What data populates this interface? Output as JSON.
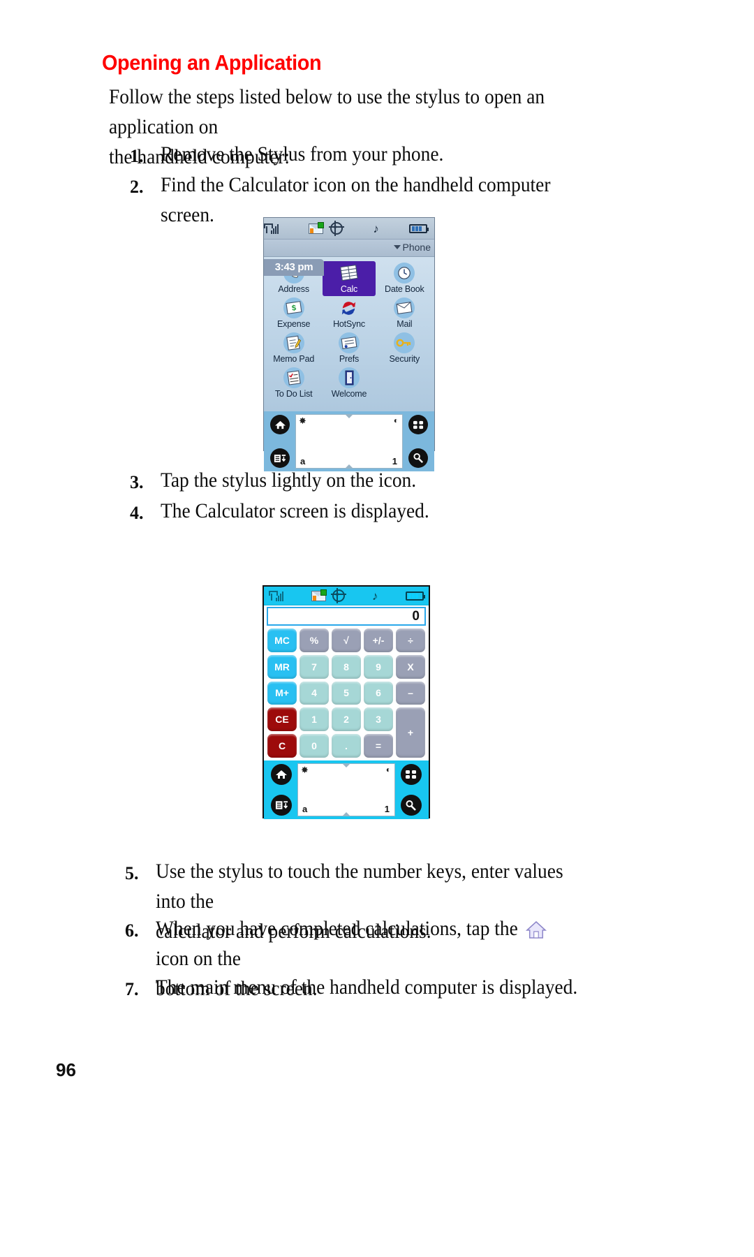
{
  "page": {
    "heading": "Opening an Application",
    "intro": "Follow the steps listed below to use the stylus to open an application on\nthe handheld computer:",
    "steps": [
      {
        "num": "1.",
        "text": "Remove the Stylus from your phone."
      },
      {
        "num": "2.",
        "text": "Find the Calculator icon on the handheld computer screen."
      },
      {
        "num": "3.",
        "text": "Tap the stylus lightly on the icon."
      },
      {
        "num": "4.",
        "text": "The Calculator screen is displayed."
      },
      {
        "num": "5.",
        "text": "Use the stylus to touch the number keys, enter values into the\ncalculator and perform calculations."
      },
      {
        "num": "6.",
        "text_before": "When you have completed calculations, tap the ",
        "text_after": " icon on the\nbottom of the screen."
      },
      {
        "num": "7.",
        "text": "The main menu of the handheld computer is displayed."
      }
    ],
    "page_number": "96",
    "heading_color": "#ff0000"
  },
  "launcher": {
    "status": {
      "signal_icon": "signal-bars-icon",
      "message_icon": "envelope-icon",
      "location_icon": "target-icon",
      "sound_icon": "music-note-icon",
      "battery_icon": "battery-icon"
    },
    "time": "3:43 pm",
    "category": "Phone",
    "category_caret": "chevron-down-icon",
    "apps": [
      {
        "label": "Address",
        "icon": "phone-handset-icon",
        "glyph": "☎",
        "selected": false
      },
      {
        "label": "Calc",
        "icon": "calculator-icon",
        "glyph": "☷",
        "selected": true
      },
      {
        "label": "Date Book",
        "icon": "clock-icon",
        "glyph": "◴",
        "selected": false
      },
      {
        "label": "Expense",
        "icon": "money-icon",
        "glyph": "$",
        "selected": false
      },
      {
        "label": "HotSync",
        "icon": "hotsync-arrows-icon",
        "glyph": "↻",
        "selected": false
      },
      {
        "label": "Mail",
        "icon": "mail-icon",
        "glyph": "✉",
        "selected": false
      },
      {
        "label": "Memo Pad",
        "icon": "memo-pencil-icon",
        "glyph": "✎",
        "selected": false
      },
      {
        "label": "Prefs",
        "icon": "prefs-list-icon",
        "glyph": "☰",
        "selected": false
      },
      {
        "label": "Security",
        "icon": "key-icon",
        "glyph": "⚷",
        "selected": false
      },
      {
        "label": "To Do List",
        "icon": "checklist-icon",
        "glyph": "✓",
        "selected": false
      },
      {
        "label": "Welcome",
        "icon": "door-icon",
        "glyph": "▯",
        "selected": false
      }
    ],
    "silk": {
      "home_icon": "home-icon",
      "menu_icon": "menu-icon",
      "apps_icon": "apps-grid-icon",
      "find_icon": "find-magnifier-icon",
      "brightness_icon": "brightness-icon",
      "contrast_icon": "contrast-icon",
      "alpha_label": "a",
      "numeric_label": "1"
    }
  },
  "calculator": {
    "status": {
      "signal_icon": "signal-bars-icon",
      "message_icon": "envelope-icon",
      "location_icon": "target-icon",
      "sound_icon": "music-note-icon",
      "battery_icon": "battery-icon"
    },
    "display_value": "0",
    "keys": [
      {
        "label": "MC",
        "type": "mem"
      },
      {
        "label": "%",
        "type": "op"
      },
      {
        "label": "√",
        "type": "op"
      },
      {
        "label": "+/-",
        "type": "op"
      },
      {
        "label": "÷",
        "type": "op"
      },
      {
        "label": "MR",
        "type": "mem"
      },
      {
        "label": "7",
        "type": "num"
      },
      {
        "label": "8",
        "type": "num"
      },
      {
        "label": "9",
        "type": "num"
      },
      {
        "label": "X",
        "type": "op"
      },
      {
        "label": "M+",
        "type": "mem"
      },
      {
        "label": "4",
        "type": "num"
      },
      {
        "label": "5",
        "type": "num"
      },
      {
        "label": "6",
        "type": "num"
      },
      {
        "label": "–",
        "type": "op"
      },
      {
        "label": "CE",
        "type": "clr"
      },
      {
        "label": "1",
        "type": "num"
      },
      {
        "label": "2",
        "type": "num"
      },
      {
        "label": "3",
        "type": "num"
      },
      {
        "label": "+",
        "type": "op",
        "span": 2
      },
      {
        "label": "C",
        "type": "clr"
      },
      {
        "label": "0",
        "type": "num"
      },
      {
        "label": ".",
        "type": "num"
      },
      {
        "label": "=",
        "type": "op"
      }
    ],
    "silk": {
      "home_icon": "home-icon",
      "menu_icon": "menu-icon",
      "apps_icon": "apps-grid-icon",
      "find_icon": "find-magnifier-icon",
      "brightness_icon": "brightness-icon",
      "contrast_icon": "contrast-icon",
      "alpha_label": "a",
      "numeric_label": "1"
    }
  },
  "colors": {
    "heading": "#ff0000",
    "calc_status_bar": "#18c6f0",
    "calc_silk": "#18c6f0",
    "key_memory": "#29c0f2",
    "key_clear": "#9d0b0b",
    "key_number": "#a6d7d6",
    "key_operator": "#9aa0b5",
    "launcher_selected": "#4b1ea8",
    "launcher_silk": "#7cb8dd"
  }
}
